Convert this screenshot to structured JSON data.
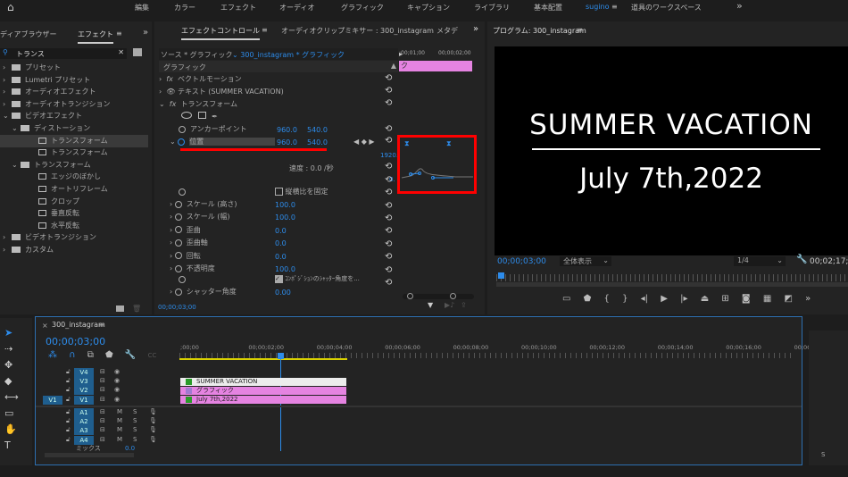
{
  "menu": {
    "items": [
      "編集",
      "カラー",
      "エフェクト",
      "オーディオ",
      "グラフィック",
      "キャプション",
      "ライブラリ",
      "基本配置",
      "sugino",
      "道具のワークスペース"
    ],
    "more": "»"
  },
  "effects_panel": {
    "tab_media": "ディアブラウザー",
    "tab_effects": "エフェクト",
    "search_value": "トランス",
    "tree": [
      {
        "label": "プリセット",
        "level": 0,
        "type": "preset",
        "open": false
      },
      {
        "label": "Lumetri プリセット",
        "level": 0,
        "type": "preset",
        "open": false
      },
      {
        "label": "オーディオエフェクト",
        "level": 0,
        "type": "folder",
        "open": false
      },
      {
        "label": "オーディオトランジション",
        "level": 0,
        "type": "folder",
        "open": false
      },
      {
        "label": "ビデオエフェクト",
        "level": 0,
        "type": "folder",
        "open": true
      },
      {
        "label": "ディストーション",
        "level": 1,
        "type": "folder",
        "open": true
      },
      {
        "label": "トランスフォーム",
        "level": 2,
        "type": "fx",
        "selected": true
      },
      {
        "label": "トランスフォーム",
        "level": 2,
        "type": "fx"
      },
      {
        "label": "トランスフォーム",
        "level": 1,
        "type": "folder",
        "open": true
      },
      {
        "label": "エッジのぼかし",
        "level": 2,
        "type": "fx"
      },
      {
        "label": "オートリフレーム",
        "level": 2,
        "type": "fx"
      },
      {
        "label": "クロップ",
        "level": 2,
        "type": "fx"
      },
      {
        "label": "垂直反転",
        "level": 2,
        "type": "fx"
      },
      {
        "label": "水平反転",
        "level": 2,
        "type": "fx"
      },
      {
        "label": "ビデオトランジション",
        "level": 0,
        "type": "folder",
        "open": false
      },
      {
        "label": "カスタム",
        "level": 0,
        "type": "folder",
        "open": false
      }
    ]
  },
  "effect_controls": {
    "tab": "エフェクトコントロール",
    "tab_audio": "オーディオクリップミキサー : 300_instagram",
    "tab_meta": "メタデ",
    "source": "ソース * グラフィック",
    "clip": "300_instagram * グラフィック",
    "tl_ticks": [
      ":00;01;00",
      "00;00;02;00"
    ],
    "clip_bar": "ク",
    "section": "グラフィック",
    "effects": [
      "ベクトルモーション",
      "テキスト (SUMMER VACATION)",
      "トランスフォーム"
    ],
    "anchor": {
      "label": "アンカーポイント",
      "x": "960.0",
      "y": "540.0"
    },
    "position": {
      "label": "位置",
      "x": "960.0",
      "y": "540.0"
    },
    "graph_max": "1920.",
    "graph_min": "0.",
    "speed": "速度 : 0.0 /秒",
    "aspect": "縦横比を固定",
    "props": [
      {
        "label": "スケール (高さ)",
        "value": "100.0"
      },
      {
        "label": "スケール (幅)",
        "value": "100.0"
      },
      {
        "label": "歪曲",
        "value": "0.0"
      },
      {
        "label": "歪曲軸",
        "value": "0.0"
      },
      {
        "label": "回転",
        "value": "0.0"
      },
      {
        "label": "不透明度",
        "value": "100.0"
      }
    ],
    "shutter_check": "ｺﾝﾎﾟｼﾞｼｮﾝのｼｬｯﾀｰ角度を...",
    "shutter": {
      "label": "シャッター角度",
      "value": "0.00"
    },
    "timecode": "00;00;03;00"
  },
  "program": {
    "title": "プログラム: 300_instagram",
    "line1": "SUMMER VACATION",
    "line2": "July 7th,2022",
    "timecode": "00;00;03;00",
    "fit": "全体表示",
    "quality": "1/4",
    "duration": "00;02;17;"
  },
  "timeline": {
    "title": "300_instagram",
    "timecode": "00;00;03;00",
    "ticks": [
      ";00;00",
      "00;00;02;00",
      "00;00;04;00",
      "00;00;06;00",
      "00;00;08;00",
      "00;00;10;00",
      "00;00;12;00",
      "00;00;14;00",
      "00;00;16;00",
      "00;0C"
    ],
    "video_tracks": [
      "V4",
      "V3",
      "V2",
      "V1"
    ],
    "source_patch": "V1",
    "audio_tracks": [
      "A1",
      "A2",
      "A3",
      "A4"
    ],
    "m": "M",
    "s": "S",
    "mix": "ミックス",
    "mix_value": "0.0",
    "clips": [
      "SUMMER VACATION",
      "グラフィック",
      "July 7th,2022"
    ]
  },
  "colors": {
    "accent": "#2d8ceb",
    "clip": "#e583e1",
    "highlight": "#ff0000"
  }
}
